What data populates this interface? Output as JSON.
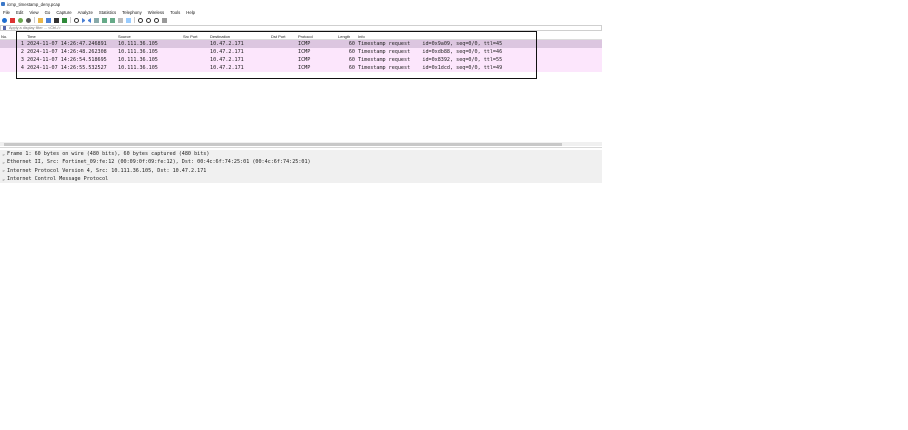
{
  "window": {
    "title": "icmp_timestamp_deny.pcap"
  },
  "menu": [
    "File",
    "Edit",
    "View",
    "Go",
    "Capture",
    "Analyze",
    "Statistics",
    "Telephony",
    "Wireless",
    "Tools",
    "Help"
  ],
  "filter": {
    "placeholder": "Apply a display filter ... <Ctrl-/>"
  },
  "columns": {
    "no": "No.",
    "time": "Time",
    "source": "Source",
    "src_port": "Src Port",
    "destination": "Destination",
    "dst_port": "Dst Port",
    "protocol": "Protocol",
    "length": "Length",
    "info": "Info"
  },
  "packets": [
    {
      "no": "1",
      "time": "2024-11-07 14:26:47.246891",
      "source": "10.111.36.105",
      "destination": "10.47.2.171",
      "protocol": "ICMP",
      "length": "60",
      "info": "Timestamp request    id=0x9a09, seq=0/0, ttl=45"
    },
    {
      "no": "2",
      "time": "2024-11-07 14:26:48.262308",
      "source": "10.111.36.105",
      "destination": "10.47.2.171",
      "protocol": "ICMP",
      "length": "60",
      "info": "Timestamp request    id=0xdb88, seq=0/0, ttl=46"
    },
    {
      "no": "3",
      "time": "2024-11-07 14:26:54.518695",
      "source": "10.111.36.105",
      "destination": "10.47.2.171",
      "protocol": "ICMP",
      "length": "60",
      "info": "Timestamp request    id=0x8392, seq=0/0, ttl=55"
    },
    {
      "no": "4",
      "time": "2024-11-07 14:26:55.532527",
      "source": "10.111.36.105",
      "destination": "10.47.2.171",
      "protocol": "ICMP",
      "length": "60",
      "info": "Timestamp request    id=0x1dcd, seq=0/0, ttl=49"
    }
  ],
  "details": [
    {
      "expander": ">",
      "text": "Frame 1: 60 bytes on wire (480 bits), 60 bytes captured (480 bits)"
    },
    {
      "expander": ">",
      "text": "Ethernet II, Src: Fortinet_09:fe:12 (00:09:0f:09:fe:12), Dst: 00:4c:6f:74:25:01 (00:4c:6f:74:25:01)"
    },
    {
      "expander": ">",
      "text": "Internet Protocol Version 4, Src: 10.111.36.105, Dst: 10.47.2.171"
    },
    {
      "expander": ">",
      "text": "Internet Control Message Protocol"
    }
  ],
  "colors": {
    "selected_row": "#dcc6e0",
    "row": "#fce6fc",
    "detail_bg": "#f0f0f0"
  }
}
